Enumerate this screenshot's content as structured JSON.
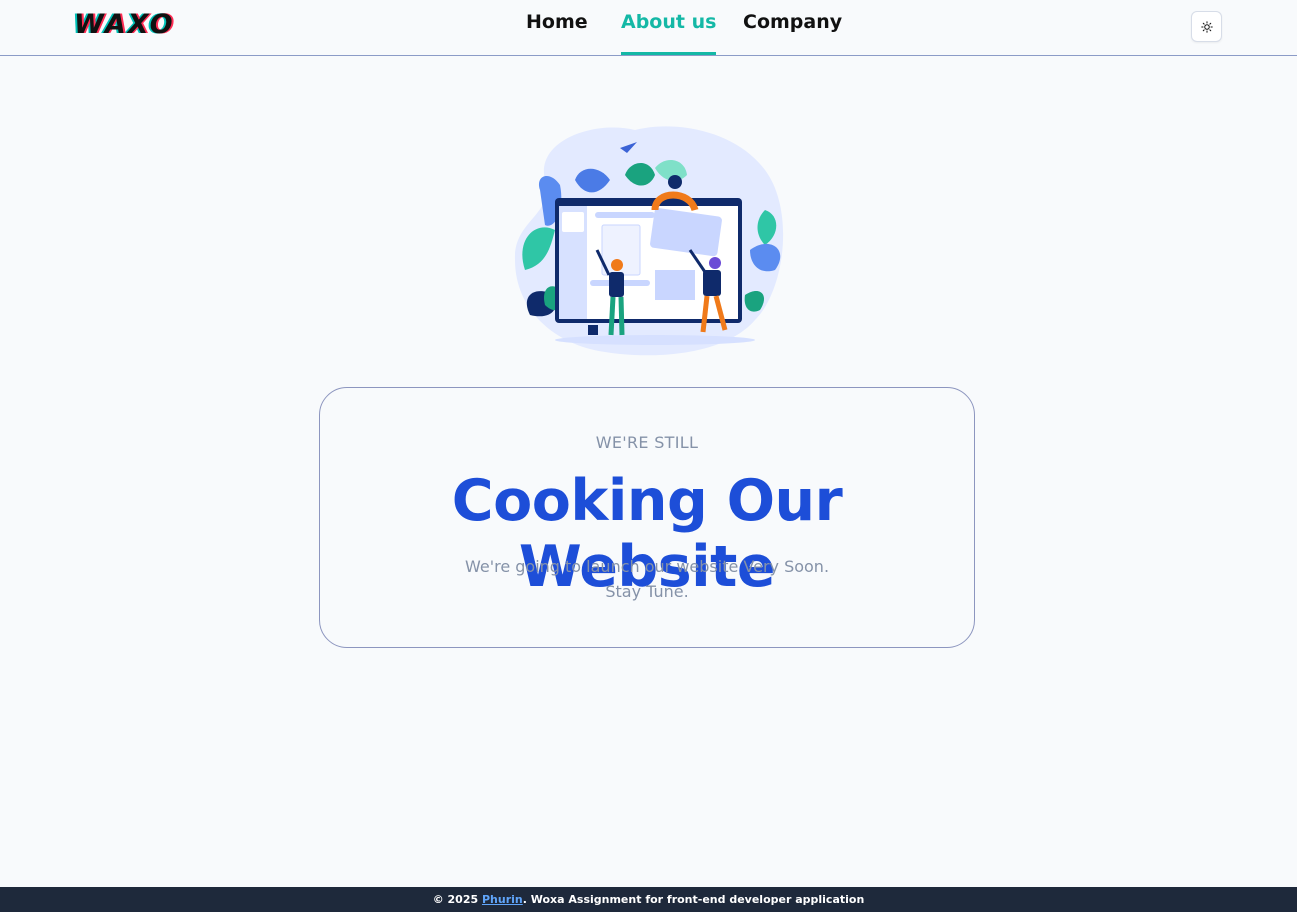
{
  "header": {
    "logo": "WAXO",
    "nav": [
      {
        "label": "Home"
      },
      {
        "label": "About us",
        "active": true
      },
      {
        "label": "Company"
      }
    ],
    "theme_toggle_icon": "sun-icon"
  },
  "main": {
    "illustration_icon": "team-building-website-illustration",
    "card": {
      "eyebrow": "WE'RE STILL",
      "headline": "Cooking Our Website",
      "line1": "We're going to launch our website Very Soon.",
      "line2": "Stay Tune."
    }
  },
  "footer": {
    "prefix": "© 2025 ",
    "link": "Phurin",
    "suffix": ". Woxa Assignment for front-end developer application"
  },
  "colors": {
    "accent": "#14b8a6",
    "headline": "#1d4ed8",
    "footer_bg": "#1e293b",
    "muted_text": "#8592a8"
  }
}
